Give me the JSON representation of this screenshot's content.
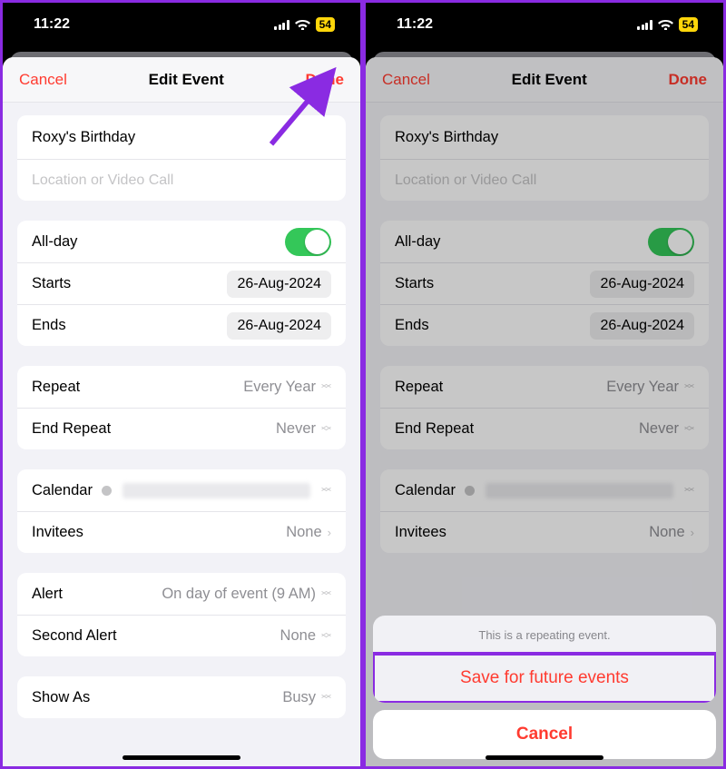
{
  "status": {
    "time": "11:22",
    "battery": "54"
  },
  "nav": {
    "cancel": "Cancel",
    "title": "Edit Event",
    "done": "Done"
  },
  "event": {
    "title": "Roxy's Birthday",
    "location_placeholder": "Location or Video Call"
  },
  "datetime": {
    "allday_label": "All-day",
    "starts_label": "Starts",
    "starts_value": "26-Aug-2024",
    "ends_label": "Ends",
    "ends_value": "26-Aug-2024"
  },
  "repeat": {
    "repeat_label": "Repeat",
    "repeat_value": "Every Year",
    "end_label": "End Repeat",
    "end_value": "Never"
  },
  "cal": {
    "calendar_label": "Calendar",
    "invitees_label": "Invitees",
    "invitees_value": "None"
  },
  "alert": {
    "alert_label": "Alert",
    "alert_value": "On day of event (9 AM)",
    "second_label": "Second Alert",
    "second_value": "None"
  },
  "show": {
    "label": "Show As",
    "value": "Busy"
  },
  "sheet": {
    "header": "This is a repeating event.",
    "save": "Save for future events",
    "cancel": "Cancel"
  }
}
